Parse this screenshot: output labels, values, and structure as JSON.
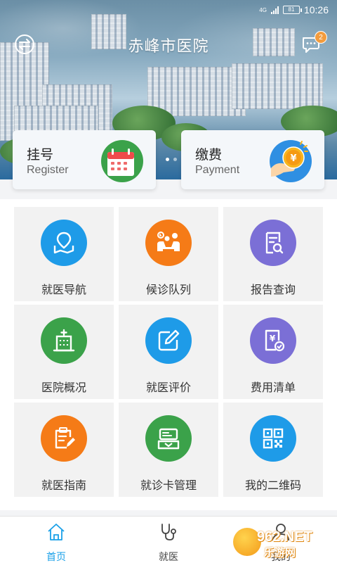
{
  "status_bar": {
    "network": "4G",
    "battery": "81",
    "time": "10:26"
  },
  "header": {
    "title": "赤峰市医院",
    "message_badge": "2"
  },
  "cards": [
    {
      "title": "挂号",
      "subtitle": "Register",
      "icon": "calendar-icon"
    },
    {
      "title": "缴费",
      "subtitle": "Payment",
      "icon": "coin-payment-icon"
    }
  ],
  "grid": [
    {
      "label": "就医导航",
      "icon": "map-navigation-icon",
      "color": "#1e9be8"
    },
    {
      "label": "候诊队列",
      "icon": "waiting-queue-icon",
      "color": "#f57b17"
    },
    {
      "label": "报告查询",
      "icon": "report-search-icon",
      "color": "#7b6fd6"
    },
    {
      "label": "医院概况",
      "icon": "hospital-building-icon",
      "color": "#3ba24a"
    },
    {
      "label": "就医评价",
      "icon": "edit-review-icon",
      "color": "#1e9be8"
    },
    {
      "label": "费用清单",
      "icon": "fee-list-icon",
      "color": "#7b6fd6"
    },
    {
      "label": "就医指南",
      "icon": "guide-clipboard-icon",
      "color": "#f57b17"
    },
    {
      "label": "就诊卡管理",
      "icon": "card-management-icon",
      "color": "#3ba24a"
    },
    {
      "label": "我的二维码",
      "icon": "qr-code-icon",
      "color": "#1e9be8"
    }
  ],
  "bottom_nav": [
    {
      "label": "首页",
      "icon": "home-icon",
      "active": true
    },
    {
      "label": "就医",
      "icon": "stethoscope-icon",
      "active": false
    },
    {
      "label": "我的",
      "icon": "user-icon",
      "active": false
    }
  ],
  "watermark": {
    "text": "962.NET",
    "sub": "乐游网"
  },
  "colors": {
    "accent": "#1aa0e8",
    "badge": "#f39c3d"
  }
}
